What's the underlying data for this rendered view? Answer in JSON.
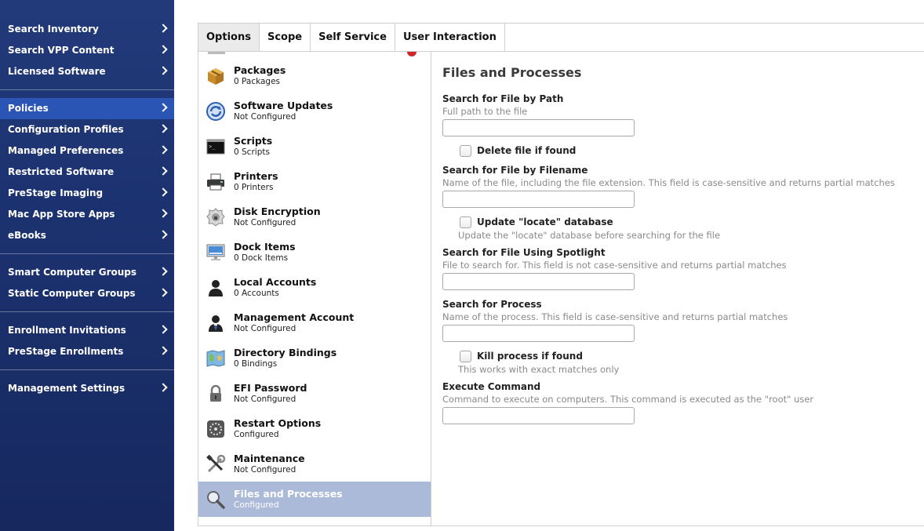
{
  "sidebar": {
    "group1": [
      {
        "label": "Search Inventory"
      },
      {
        "label": "Search VPP Content"
      },
      {
        "label": "Licensed Software"
      }
    ],
    "group2": [
      {
        "label": "Policies"
      },
      {
        "label": "Configuration Profiles"
      },
      {
        "label": "Managed Preferences"
      },
      {
        "label": "Restricted Software"
      },
      {
        "label": "PreStage Imaging"
      },
      {
        "label": "Mac App Store Apps"
      },
      {
        "label": "eBooks"
      }
    ],
    "group3": [
      {
        "label": "Smart Computer Groups"
      },
      {
        "label": "Static Computer Groups"
      }
    ],
    "group4": [
      {
        "label": "Enrollment Invitations"
      },
      {
        "label": "PreStage Enrollments"
      }
    ],
    "group5": [
      {
        "label": "Management Settings"
      }
    ],
    "active": "Policies"
  },
  "tabs": [
    {
      "label": "Options"
    },
    {
      "label": "Scope"
    },
    {
      "label": "Self Service"
    },
    {
      "label": "User Interaction"
    }
  ],
  "payloads": [
    {
      "title": "Packages",
      "sub": "0 Packages",
      "icon": "package-icon"
    },
    {
      "title": "Software Updates",
      "sub": "Not Configured",
      "icon": "software-update-icon"
    },
    {
      "title": "Scripts",
      "sub": "0 Scripts",
      "icon": "terminal-icon"
    },
    {
      "title": "Printers",
      "sub": "0 Printers",
      "icon": "printer-icon"
    },
    {
      "title": "Disk Encryption",
      "sub": "Not Configured",
      "icon": "disk-encryption-icon"
    },
    {
      "title": "Dock Items",
      "sub": "0 Dock Items",
      "icon": "monitor-icon"
    },
    {
      "title": "Local Accounts",
      "sub": "0 Accounts",
      "icon": "user-icon"
    },
    {
      "title": "Management Account",
      "sub": "Not Configured",
      "icon": "admin-user-icon"
    },
    {
      "title": "Directory Bindings",
      "sub": "0 Bindings",
      "icon": "map-icon"
    },
    {
      "title": "EFI Password",
      "sub": "Not Configured",
      "icon": "lock-icon"
    },
    {
      "title": "Restart Options",
      "sub": "Configured",
      "icon": "restart-icon"
    },
    {
      "title": "Maintenance",
      "sub": "Not Configured",
      "icon": "tools-icon"
    },
    {
      "title": "Files and Processes",
      "sub": "Configured",
      "icon": "magnifier-icon"
    }
  ],
  "form": {
    "title": "Files and Processes",
    "path": {
      "label": "Search for File by Path",
      "help": "Full path to the file",
      "value": ""
    },
    "delete": {
      "label": "Delete file if found",
      "checked": false
    },
    "filename": {
      "label": "Search for File by Filename",
      "help": "Name of the file, including the file extension. This field is case-sensitive and returns partial matches",
      "value": ""
    },
    "locate": {
      "label": "Update \"locate\" database",
      "help": "Update the \"locate\" database before searching for the file",
      "checked": false
    },
    "spotlight": {
      "label": "Search for File Using Spotlight",
      "help": "File to search for. This field is not case-sensitive and returns partial matches",
      "value": ""
    },
    "process": {
      "label": "Search for Process",
      "help": "Name of the process. This field is case-sensitive and returns partial matches",
      "value": ""
    },
    "kill": {
      "label": "Kill process if found",
      "help": "This works with exact matches only",
      "checked": false
    },
    "command": {
      "label": "Execute Command",
      "help": "Command to execute on computers. This command is executed as the \"root\" user",
      "value": ""
    }
  }
}
